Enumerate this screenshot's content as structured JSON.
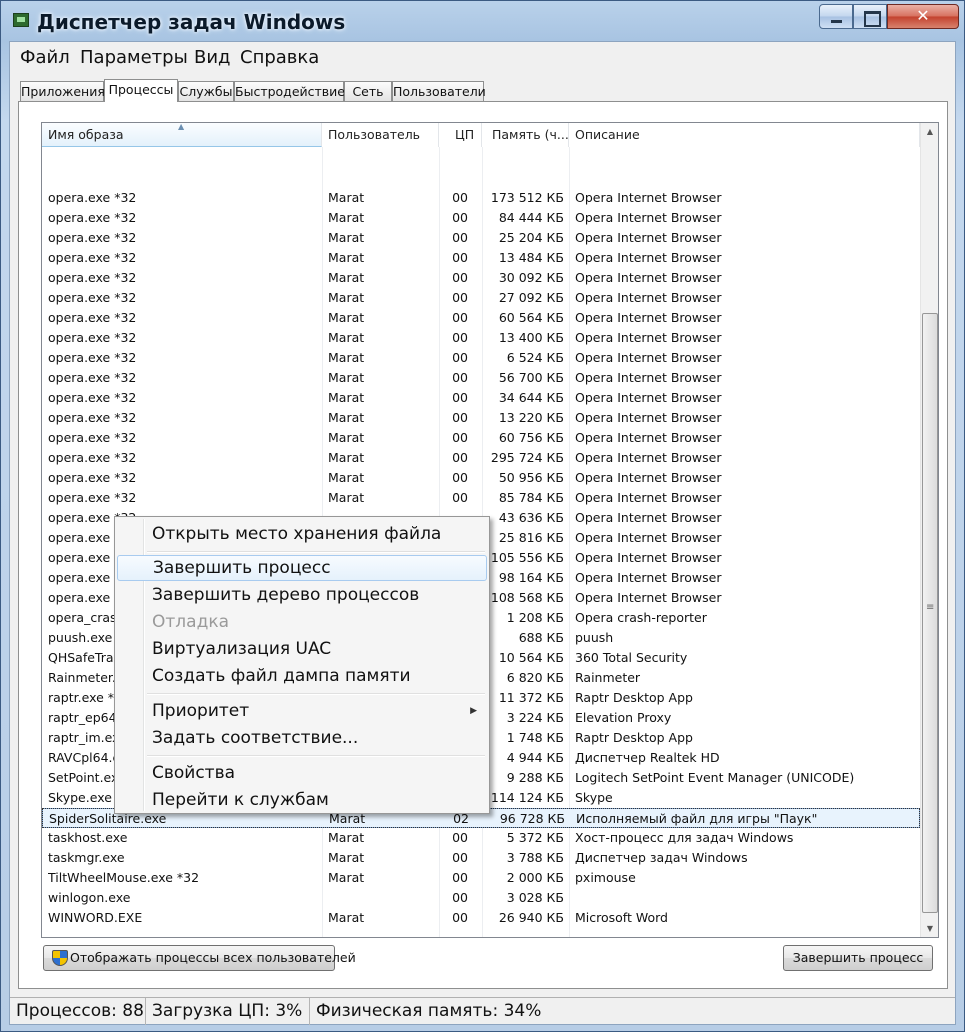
{
  "window": {
    "title": "Диспетчер задач Windows",
    "close_glyph": "✕"
  },
  "menu": [
    "Файл",
    "Параметры",
    "Вид",
    "Справка"
  ],
  "tabs": [
    "Приложения",
    "Процессы",
    "Службы",
    "Быстродействие",
    "Сеть",
    "Пользователи"
  ],
  "active_tab": "Процессы",
  "columns": {
    "name": "Имя образа",
    "user": "Пользователь",
    "cpu": "ЦП",
    "memory": "Память (ч...",
    "description": "Описание"
  },
  "rows": [
    {
      "name": "opera.exe *32",
      "user": "Marat",
      "cpu": "00",
      "mem": "173 512 КБ",
      "desc": "Opera Internet Browser"
    },
    {
      "name": "opera.exe *32",
      "user": "Marat",
      "cpu": "00",
      "mem": "84 444 КБ",
      "desc": "Opera Internet Browser"
    },
    {
      "name": "opera.exe *32",
      "user": "Marat",
      "cpu": "00",
      "mem": "25 204 КБ",
      "desc": "Opera Internet Browser"
    },
    {
      "name": "opera.exe *32",
      "user": "Marat",
      "cpu": "00",
      "mem": "13 484 КБ",
      "desc": "Opera Internet Browser"
    },
    {
      "name": "opera.exe *32",
      "user": "Marat",
      "cpu": "00",
      "mem": "30 092 КБ",
      "desc": "Opera Internet Browser"
    },
    {
      "name": "opera.exe *32",
      "user": "Marat",
      "cpu": "00",
      "mem": "27 092 КБ",
      "desc": "Opera Internet Browser"
    },
    {
      "name": "opera.exe *32",
      "user": "Marat",
      "cpu": "00",
      "mem": "60 564 КБ",
      "desc": "Opera Internet Browser"
    },
    {
      "name": "opera.exe *32",
      "user": "Marat",
      "cpu": "00",
      "mem": "13 400 КБ",
      "desc": "Opera Internet Browser"
    },
    {
      "name": "opera.exe *32",
      "user": "Marat",
      "cpu": "00",
      "mem": "6 524 КБ",
      "desc": "Opera Internet Browser"
    },
    {
      "name": "opera.exe *32",
      "user": "Marat",
      "cpu": "00",
      "mem": "56 700 КБ",
      "desc": "Opera Internet Browser"
    },
    {
      "name": "opera.exe *32",
      "user": "Marat",
      "cpu": "00",
      "mem": "34 644 КБ",
      "desc": "Opera Internet Browser"
    },
    {
      "name": "opera.exe *32",
      "user": "Marat",
      "cpu": "00",
      "mem": "13 220 КБ",
      "desc": "Opera Internet Browser"
    },
    {
      "name": "opera.exe *32",
      "user": "Marat",
      "cpu": "00",
      "mem": "60 756 КБ",
      "desc": "Opera Internet Browser"
    },
    {
      "name": "opera.exe *32",
      "user": "Marat",
      "cpu": "00",
      "mem": "295 724 КБ",
      "desc": "Opera Internet Browser"
    },
    {
      "name": "opera.exe *32",
      "user": "Marat",
      "cpu": "00",
      "mem": "50 956 КБ",
      "desc": "Opera Internet Browser"
    },
    {
      "name": "opera.exe *32",
      "user": "Marat",
      "cpu": "00",
      "mem": "85 784 КБ",
      "desc": "Opera Internet Browser"
    },
    {
      "name": "opera.exe *32",
      "user": "",
      "cpu": "",
      "mem": "43 636 КБ",
      "desc": "Opera Internet Browser"
    },
    {
      "name": "opera.exe *32",
      "user": "",
      "cpu": "",
      "mem": "25 816 КБ",
      "desc": "Opera Internet Browser"
    },
    {
      "name": "opera.exe *32",
      "user": "",
      "cpu": "",
      "mem": "105 556 КБ",
      "desc": "Opera Internet Browser"
    },
    {
      "name": "opera.exe *32",
      "user": "",
      "cpu": "",
      "mem": "98 164 КБ",
      "desc": "Opera Internet Browser"
    },
    {
      "name": "opera.exe *32",
      "user": "",
      "cpu": "",
      "mem": "108 568 КБ",
      "desc": "Opera Internet Browser"
    },
    {
      "name": "opera_crash",
      "user": "",
      "cpu": "",
      "mem": "1 208 КБ",
      "desc": "Opera crash-reporter"
    },
    {
      "name": "puush.exe *",
      "user": "",
      "cpu": "",
      "mem": "688 КБ",
      "desc": "puush"
    },
    {
      "name": "QHSafeTray",
      "user": "",
      "cpu": "",
      "mem": "10 564 КБ",
      "desc": "360 Total Security"
    },
    {
      "name": "Rainmeter.e",
      "user": "",
      "cpu": "",
      "mem": "6 820 КБ",
      "desc": "Rainmeter"
    },
    {
      "name": "raptr.exe *3",
      "user": "",
      "cpu": "",
      "mem": "11 372 КБ",
      "desc": "Raptr Desktop App"
    },
    {
      "name": "raptr_ep64.",
      "user": "",
      "cpu": "",
      "mem": "3 224 КБ",
      "desc": "Elevation Proxy"
    },
    {
      "name": "raptr_im.exe",
      "user": "",
      "cpu": "",
      "mem": "1 748 КБ",
      "desc": "Raptr Desktop App"
    },
    {
      "name": "RAVCpl64.e",
      "user": "",
      "cpu": "",
      "mem": "4 944 КБ",
      "desc": "Диспетчер Realtek HD"
    },
    {
      "name": "SetPoint.exe",
      "user": "",
      "cpu": "",
      "mem": "9 288 КБ",
      "desc": "Logitech SetPoint Event Manager (UNICODE)"
    },
    {
      "name": "Skype.exe *",
      "user": "",
      "cpu": "",
      "mem": "114 124 КБ",
      "desc": "Skype"
    },
    {
      "name": "SpiderSolitaire.exe",
      "user": "Marat",
      "cpu": "02",
      "mem": "96 728 КБ",
      "desc": "Исполняемый файл для игры \"Паук\""
    },
    {
      "name": "taskhost.exe",
      "user": "Marat",
      "cpu": "00",
      "mem": "5 372 КБ",
      "desc": "Хост-процесс для задач Windows"
    },
    {
      "name": "taskmgr.exe",
      "user": "Marat",
      "cpu": "00",
      "mem": "3 788 КБ",
      "desc": "Диспетчер задач Windows"
    },
    {
      "name": "TiltWheelMouse.exe *32",
      "user": "Marat",
      "cpu": "00",
      "mem": "2 000 КБ",
      "desc": "pximouse"
    },
    {
      "name": "winlogon.exe",
      "user": "",
      "cpu": "00",
      "mem": "3 028 КБ",
      "desc": ""
    },
    {
      "name": "WINWORD.EXE",
      "user": "Marat",
      "cpu": "00",
      "mem": "26 940 КБ",
      "desc": "Microsoft Word"
    }
  ],
  "selected_row": "SpiderSolitaire.exe",
  "buttons": {
    "show_all": "Отображать процессы всех пользователей",
    "end_process": "Завершить процесс"
  },
  "status": {
    "processes": "Процессов: 88",
    "cpu": "Загрузка ЦП: 3%",
    "memory": "Физическая память: 34%"
  },
  "context_menu": {
    "open_location": "Открыть место хранения файла",
    "end_process": "Завершить процесс",
    "end_tree": "Завершить дерево процессов",
    "debug": "Отладка",
    "uac": "Виртуализация UAC",
    "dump": "Создать файл дампа памяти",
    "priority": "Приоритет",
    "affinity": "Задать соответствие...",
    "properties": "Свойства",
    "go_services": "Перейти к службам"
  }
}
